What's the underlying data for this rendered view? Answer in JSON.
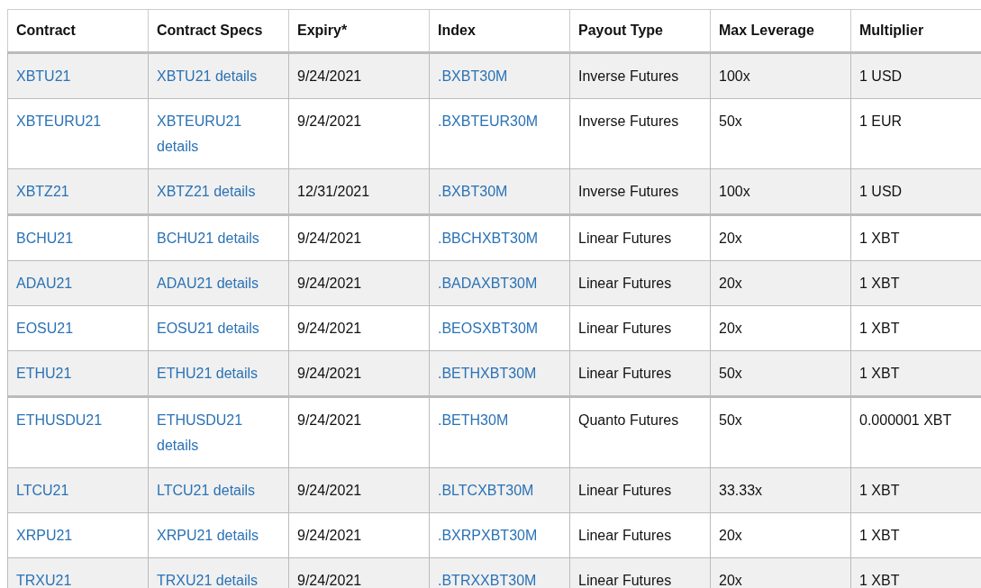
{
  "table": {
    "columns": [
      {
        "label": "Contract",
        "kind": "link"
      },
      {
        "label": "Contract Specs",
        "kind": "link"
      },
      {
        "label": "Expiry*",
        "kind": "text"
      },
      {
        "label": "Index",
        "kind": "link"
      },
      {
        "label": "Payout Type",
        "kind": "text"
      },
      {
        "label": "Max Leverage",
        "kind": "text"
      },
      {
        "label": "Multiplier",
        "kind": "text"
      }
    ],
    "groups": [
      {
        "rows": [
          [
            "XBTU21",
            "XBTU21 details",
            "9/24/2021",
            ".BXBT30M",
            "Inverse Futures",
            "100x",
            "1 USD"
          ],
          [
            "XBTEURU21",
            "XBTEURU21 details",
            "9/24/2021",
            ".BXBTEUR30M",
            "Inverse Futures",
            "50x",
            "1 EUR"
          ],
          [
            "XBTZ21",
            "XBTZ21 details",
            "12/31/2021",
            ".BXBT30M",
            "Inverse Futures",
            "100x",
            "1 USD"
          ]
        ]
      },
      {
        "rows": [
          [
            "BCHU21",
            "BCHU21 details",
            "9/24/2021",
            ".BBCHXBT30M",
            "Linear Futures",
            "20x",
            "1 XBT"
          ],
          [
            "ADAU21",
            "ADAU21 details",
            "9/24/2021",
            ".BADAXBT30M",
            "Linear Futures",
            "20x",
            "1 XBT"
          ],
          [
            "EOSU21",
            "EOSU21 details",
            "9/24/2021",
            ".BEOSXBT30M",
            "Linear Futures",
            "20x",
            "1 XBT"
          ],
          [
            "ETHU21",
            "ETHU21 details",
            "9/24/2021",
            ".BETHXBT30M",
            "Linear Futures",
            "50x",
            "1 XBT"
          ]
        ]
      },
      {
        "rows": [
          [
            "ETHUSDU21",
            "ETHUSDU21 details",
            "9/24/2021",
            ".BETH30M",
            "Quanto Futures",
            "50x",
            "0.000001 XBT"
          ],
          [
            "LTCU21",
            "LTCU21 details",
            "9/24/2021",
            ".BLTCXBT30M",
            "Linear Futures",
            "33.33x",
            "1 XBT"
          ],
          [
            "XRPU21",
            "XRPU21 details",
            "9/24/2021",
            ".BXRPXBT30M",
            "Linear Futures",
            "20x",
            "1 XBT"
          ],
          [
            "TRXU21",
            "TRXU21 details",
            "9/24/2021",
            ".BTRXXBT30M",
            "Linear Futures",
            "20x",
            "1 XBT"
          ]
        ]
      }
    ]
  }
}
